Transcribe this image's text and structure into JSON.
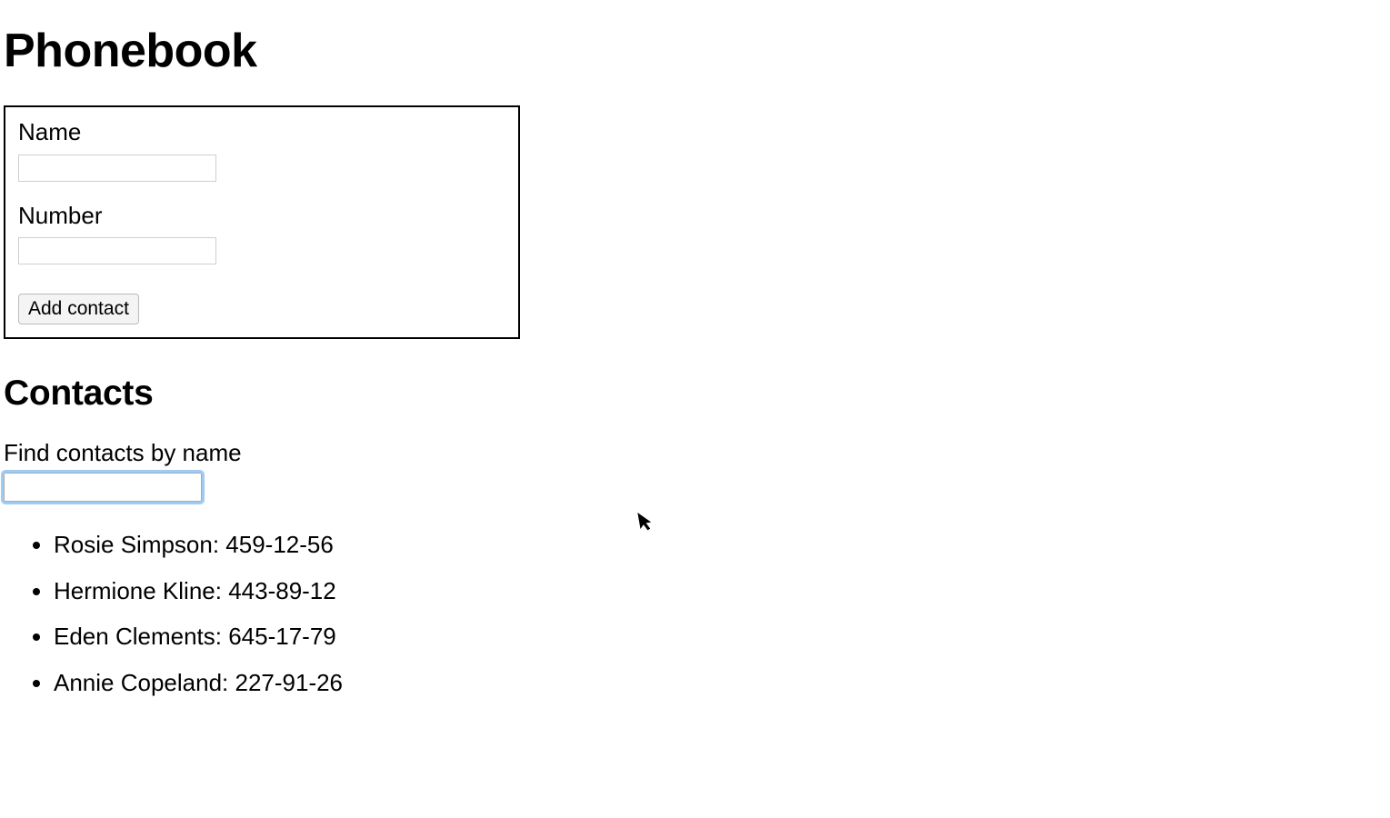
{
  "page_title": "Phonebook",
  "form": {
    "name_label": "Name",
    "name_value": "",
    "number_label": "Number",
    "number_value": "",
    "add_button_label": "Add contact"
  },
  "contacts_section": {
    "heading": "Contacts",
    "search_label": "Find contacts by name",
    "search_value": ""
  },
  "contacts": [
    {
      "name": "Rosie Simpson",
      "number": "459-12-56"
    },
    {
      "name": "Hermione Kline",
      "number": "443-89-12"
    },
    {
      "name": "Eden Clements",
      "number": "645-17-79"
    },
    {
      "name": "Annie Copeland",
      "number": "227-91-26"
    }
  ]
}
